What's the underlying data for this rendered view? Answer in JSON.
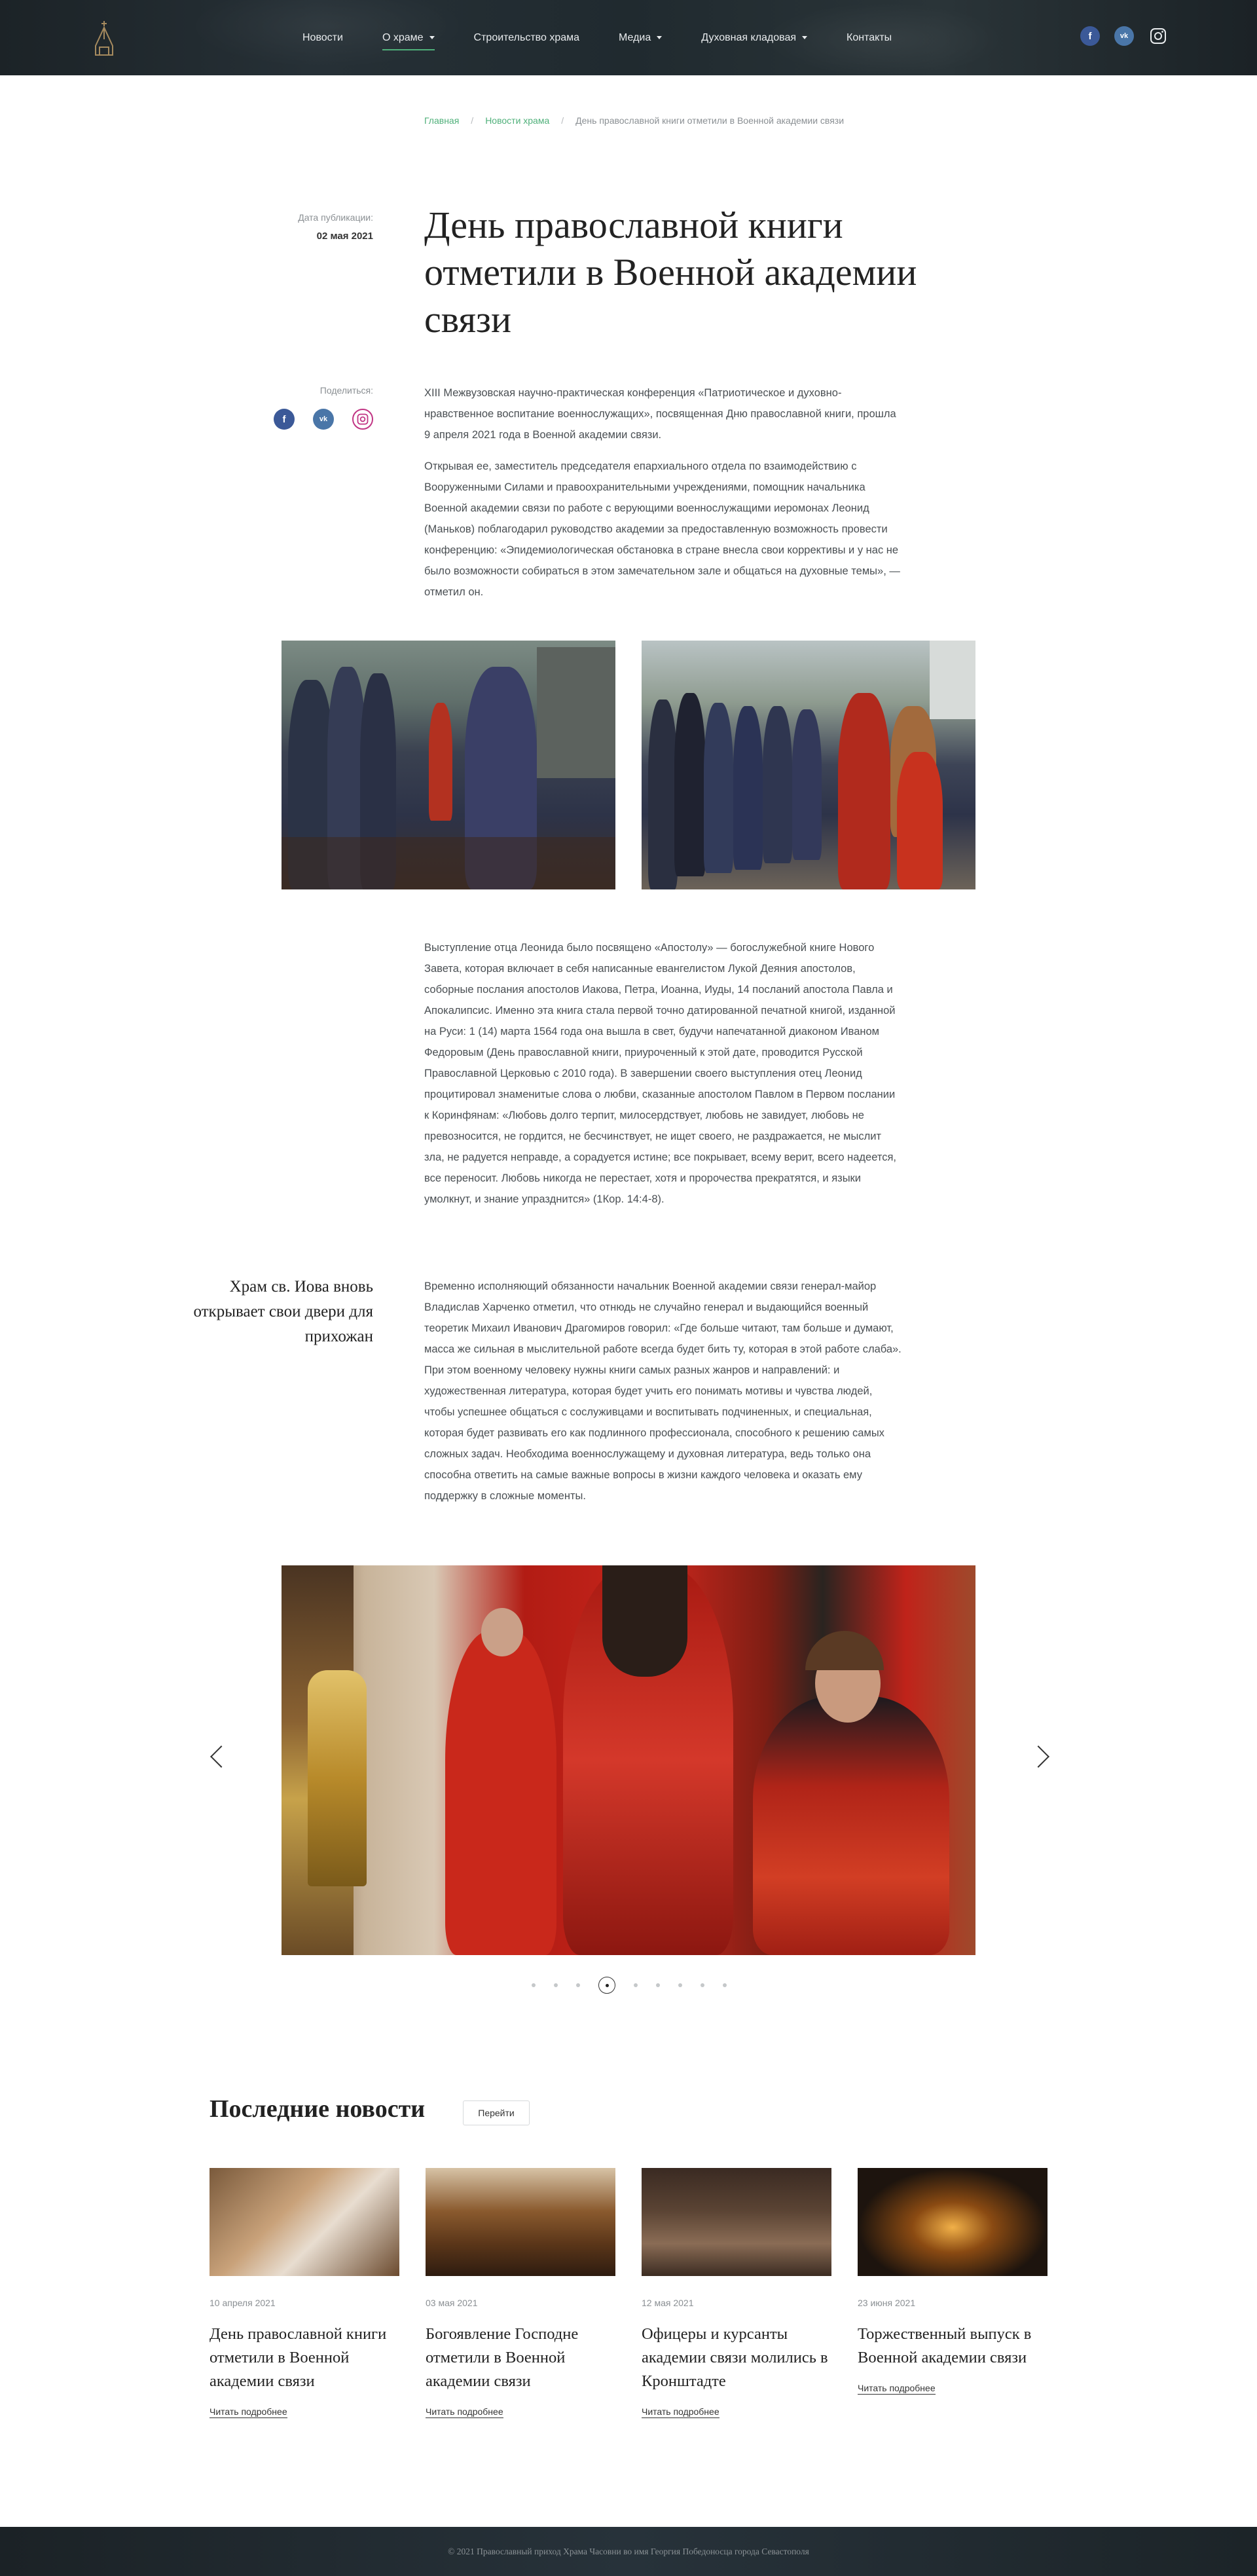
{
  "header": {
    "logo_icon": "church-logo-icon",
    "nav": [
      {
        "label": "Новости",
        "dropdown": false,
        "active": false
      },
      {
        "label": "О храме",
        "dropdown": true,
        "active": true
      },
      {
        "label": "Строительство храма",
        "dropdown": false,
        "active": false
      },
      {
        "label": "Медиа",
        "dropdown": true,
        "active": false
      },
      {
        "label": "Духовная кладовая",
        "dropdown": true,
        "active": false
      },
      {
        "label": "Контакты",
        "dropdown": false,
        "active": false
      }
    ],
    "socials": [
      "facebook-icon",
      "vk-icon",
      "instagram-icon"
    ],
    "accent_color": "#4fb07a"
  },
  "breadcrumb": {
    "home": "Главная",
    "section": "Новости храма",
    "current": "День православной книги отметили в Военной академии связи",
    "separator": "/"
  },
  "article": {
    "date_label": "Дата публикации:",
    "date": "02 мая 2021",
    "share_label": "Поделиться:",
    "title": "День православной книги отметили в Военной академии связи",
    "p1": "XIII Межвузовская научно-практическая конференция «Патриотическое и духовно-нравственное воспитание военнослужащих», посвященная Дню православной книги, прошла 9 апреля 2021 года в Военной академии связи.",
    "p2": "Открывая ее, заместитель председателя епархиального отдела по взаимодействию с Вооруженными Силами и правоохранительными учреждениями, помощник начальника Военной академии связи по работе с верующими военнослужащими иеромонах Леонид (Маньков) поблагодарил руководство академии за предоставленную возможность провести конференцию: «Эпидемиологическая обстановка в стране внесла свои коррективы и у нас не было возможности собираться в этом замечательном зале и общаться на духовные темы», — отметил он.",
    "p3": "Выступление отца Леонида было посвящено «Апостолу» — богослужебной книге Нового Завета, которая включает в себя написанные евангелистом Лукой Деяния апостолов, соборные послания апостолов Иакова, Петра, Иоанна, Иуды, 14 посланий апостола Павла и Апокалипсис. Именно эта книга стала первой точно датированной печатной книгой, изданной на Руси: 1 (14) марта 1564 года она вышла в свет, будучи напечатанной диаконом Иваном Федоровым (День православной книги, приуроченный к этой дате, проводится Русской Православной Церковью с 2010 года). В завершении своего выступления отец Леонид процитировал знаменитые слова о любви, сказанные апостолом Павлом в Первом послании к Коринфянам: «Любовь долго терпит, милосердствует, любовь не завидует, любовь не превозносится, не гордится, не бесчинствует, не ищет своего, не раздражается, не мыслит зла, не радуется неправде, а сорадуется истине; все покрывает, всему верит, всего надеется, все переносит. Любовь никогда не перестает, хотя и пророчества прекратятся, и языки умолкнут, и знание упразднится» (1Кор. 14:4-8).",
    "quote": "Храм св. Иова вновь открывает свои двери для прихожан",
    "p4": "Временно исполняющий обязанности начальник Военной академии связи генерал-майор Владислав Харченко отметил, что отнюдь не случайно генерал и выдающийся военный теоретик Михаил Иванович Драгомиров говорил: «Где больше читают, там больше и думают, масса же сильная в мыслительной работе всегда будет бить ту, которая в этой работе слаба». При этом военному человеку нужны книги самых разных жанров и направлений: и художественная литература, которая будет учить его понимать мотивы и чувства людей, чтобы успешнее общаться с сослуживцами и воспитывать подчиненных, и специальная, которая будет развивать его как подлинного профессионала, способного к решению самых сложных задач. Необходима военнослужащему и духовная литература, ведь только она способна ответить на самые важные вопросы в жизни каждого человека и оказать ему поддержку в сложные моменты."
  },
  "gallery": {
    "slide_count": 9,
    "active_slide": 4,
    "prev_icon": "chevron-left-icon",
    "next_icon": "chevron-right-icon"
  },
  "latest_news": {
    "heading": "Последние новости",
    "button": "Перейти",
    "cards": [
      {
        "date": "10 апреля 2021",
        "title": "День православной книги отметили в Военной академии связи",
        "more": "Читать подробнее"
      },
      {
        "date": "03 мая 2021",
        "title": "Богоявление Господне отметили в Военной академии связи",
        "more": "Читать подробнее"
      },
      {
        "date": "12 мая 2021",
        "title": "Офицеры и курсанты академии связи молились в Кронштадте",
        "more": "Читать подробнее"
      },
      {
        "date": "23 июня 2021",
        "title": "Торжественный выпуск в Военной академии связи",
        "more": "Читать подробнее"
      }
    ]
  },
  "footer": {
    "copyright": "© 2021 Православный приход Храма Часовни во имя Георгия Победоносца города Севастополя"
  }
}
